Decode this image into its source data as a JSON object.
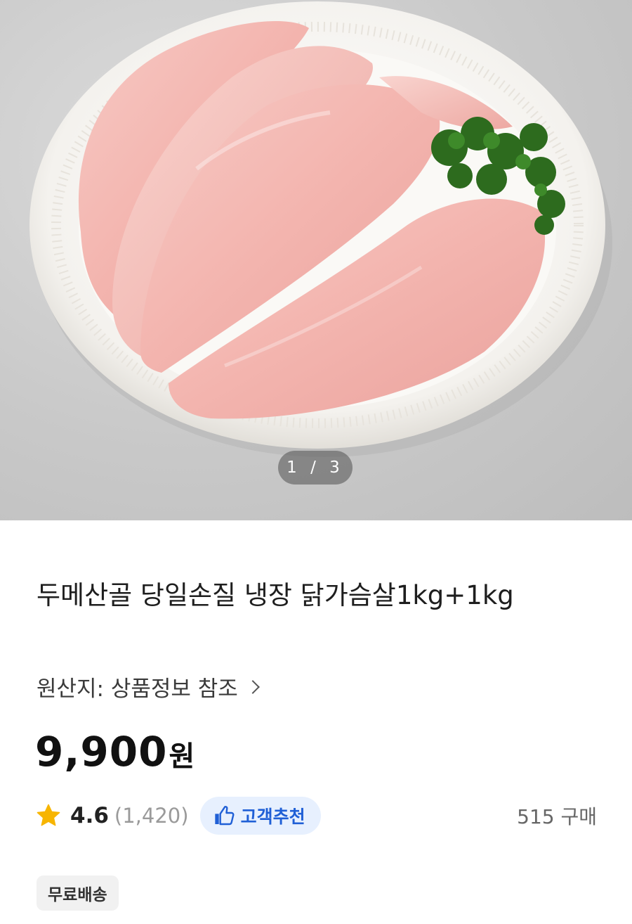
{
  "product": {
    "image_counter": "1 / 3",
    "title": "두메산골 당일손질 냉장 닭가슴살1kg+1kg",
    "origin": "원산지: 상품정보 참조",
    "price_amount": "9,900",
    "price_unit": "원",
    "rating": "4.6",
    "review_count": "(1,420)",
    "recommend_badge": "고객추천",
    "purchase_count": "515 구매",
    "shipping_badge": "무료배송"
  },
  "colors": {
    "accent_blue": "#1f5fd6",
    "badge_bg": "#e7f0fe",
    "star": "#f7b500"
  },
  "icons": {
    "star": "star-icon",
    "thumb": "thumbs-up-icon",
    "chevron": "chevron-right-icon"
  }
}
